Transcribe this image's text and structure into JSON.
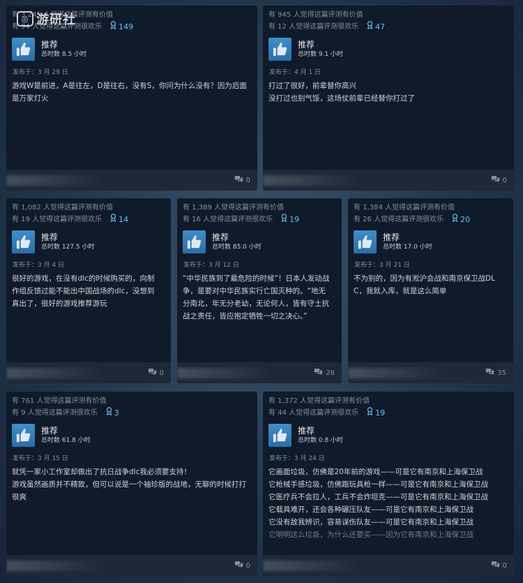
{
  "watermark": {
    "text": "游研社"
  },
  "icons": {
    "award": "award-ribbon-icon",
    "thumb": "thumbs-up-icon",
    "comment": "comment-bubble-icon"
  },
  "colors": {
    "accent": "#66c0f4",
    "card_bg": "#0f1a2a",
    "footer_bg": "#1d2938"
  },
  "reviews": [
    {
      "helpful": "有 3,245 人觉得这篇评测有价值",
      "funny": "有 94 人觉得这篇评测很欢乐",
      "awards": "149",
      "recommend": "推荐",
      "hours": "总时数 8.5 小时",
      "posted": "发布于：3 月 29 日",
      "body": [
        "游戏W是前进，A是往左，D是往右，没有S，你问为什么没有？因为后面是万家灯火"
      ],
      "comments": "0"
    },
    {
      "helpful": "有 945 人觉得这篇评测有价值",
      "funny": "有 12 人觉得这篇评测很欢乐",
      "awards": "47",
      "recommend": "推荐",
      "hours": "总时数 9.1 小时",
      "posted": "发布于：4 月 1 日",
      "body": [
        "打过了很好，前辈替你高兴",
        "没打过也别气馁，这场仗前辈已经替你打过了"
      ],
      "comments": "0"
    },
    {
      "helpful": "有 1,082 人觉得这篇评测有价值",
      "funny": "有 19 人觉得这篇评测很欢乐",
      "awards": "14",
      "recommend": "推荐",
      "hours": "总时数 127.5 小时",
      "posted": "发布于：3 月 4 日",
      "body": [
        "很好的游戏，在没有dlc的时候购买的，向制作组反馈过能不能出中国战场的dlc，没想到真出了，很好的游戏推荐游玩"
      ],
      "comments": "0"
    },
    {
      "helpful": "有 1,389 人觉得这篇评测有价值",
      "funny": "有 16 人觉得这篇评测很欢乐",
      "awards": "19",
      "recommend": "推荐",
      "hours": "总时数 85.0 小时",
      "posted": "发布于：3 月 12 日",
      "body": [
        "“中华民族到了最危险的时候”！日本人发动战争，是要对中华民族实行亡国灭种的。“地无分南北，年无分老幼，无论何人，皆有守土抗战之责任，皆应抱定牺牲一切之决心。”"
      ],
      "comments": "26"
    },
    {
      "helpful": "有 1,384 人觉得这篇评测有价值",
      "funny": "有 26 人觉得这篇评测很欢乐",
      "awards": "20",
      "recommend": "推荐",
      "hours": "总时数 17.0 小时",
      "posted": "发布于：3 月 21 日",
      "body": [
        "不为别的，因为有淞沪会战和南京保卫战DLC，我就入库，就是这么简单"
      ],
      "comments": "35"
    },
    {
      "helpful": "有 761 人觉得这篇评测有价值",
      "funny": "有 9 人觉得这篇评测很欢乐",
      "awards": "3",
      "recommend": "推荐",
      "hours": "总时数 61.8 小时",
      "posted": "发布于：3 月 15 日",
      "body": [
        "就凭一家小工作室却做出了抗日战争dlc我必须要支持！",
        "游戏虽然画质并不精致，但可以说是一个袖珍版的战地，无聊的时候打打很爽"
      ],
      "comments": "0"
    },
    {
      "helpful": "有 1,372 人觉得这篇评测有价值",
      "funny": "有 44 人觉得这篇评测很欢乐",
      "awards": "19",
      "recommend": "推荐",
      "hours": "总时数 0.8 小时",
      "posted": "发布于：3 月 24 日",
      "body": [
        "它画面垃圾，仿佛是20年前的游戏——可是它有南京和上海保卫战",
        "它枪械手感垃圾，仿佛跟玩具枪一样——可是它有南京和上海保卫战",
        "它医疗兵不会拉人，工兵不会炸坦克——可是它有南京和上海保卫战",
        "它载具难开，还会各种碾压队友——可是它有南京和上海保卫战",
        "它没有敌我辨识，容易误伤队友——可是它有南京和上海保卫战",
        "它明明这么垃圾，为什么还要买——因为它有南京和上海保卫战"
      ],
      "comments": "0"
    }
  ]
}
